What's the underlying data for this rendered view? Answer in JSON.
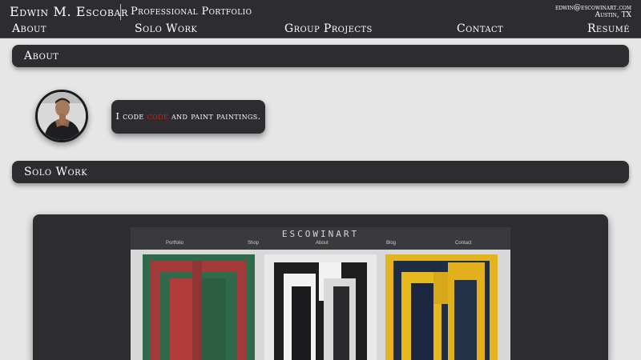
{
  "header": {
    "name": "Edwin M. Escobar",
    "subtitle": "Professional Portfolio",
    "email": "edwin@escowinart.com",
    "location": "Austin, TX"
  },
  "nav": {
    "about": "About",
    "solo": "Solo Work",
    "group": "Group Projects",
    "contact": "Contact",
    "resume": "Resumé"
  },
  "about": {
    "heading": "About",
    "bio_prefix": "I code ",
    "bio_highlight": "code",
    "bio_suffix": " and paint paintings.",
    "highlight_color": "#cc2222"
  },
  "solo": {
    "heading": "Solo Work",
    "screenshot": {
      "logo": "ESCOWINART",
      "nav": [
        "Portfolio",
        "Shop",
        "About",
        "Blog",
        "Contact"
      ],
      "paintings": [
        "red-green-painting",
        "black-white-painting",
        "yellow-navy-painting"
      ]
    }
  },
  "colors": {
    "bar": "#2d2c31",
    "background": "#e6e6e6"
  }
}
